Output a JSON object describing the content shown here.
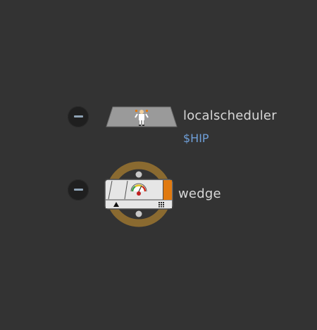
{
  "network": {
    "background_color": "#333333",
    "nodes": [
      {
        "name": "localscheduler",
        "label": "localscheduler",
        "sublabel": "$HIP",
        "icon": "scheduler-worker-icon",
        "shape": "trapezoid"
      },
      {
        "name": "wedge",
        "label": "wedge",
        "icon": "gauge-meter-icon",
        "shape": "rounded-rect-with-ring",
        "selected": true,
        "has_input": true,
        "has_output": true
      }
    ]
  },
  "colors": {
    "label_text": "#d8d8d8",
    "sublabel_text": "#6f9fd8",
    "selection_ring": "#8a6a30",
    "node_fill_gray": "#9a9a9a",
    "node_fill_light": "#e6e6e6",
    "accent_orange": "#e07a10",
    "bypass_dot": "#1f1f1f",
    "bypass_bar": "#8fa3b5"
  }
}
